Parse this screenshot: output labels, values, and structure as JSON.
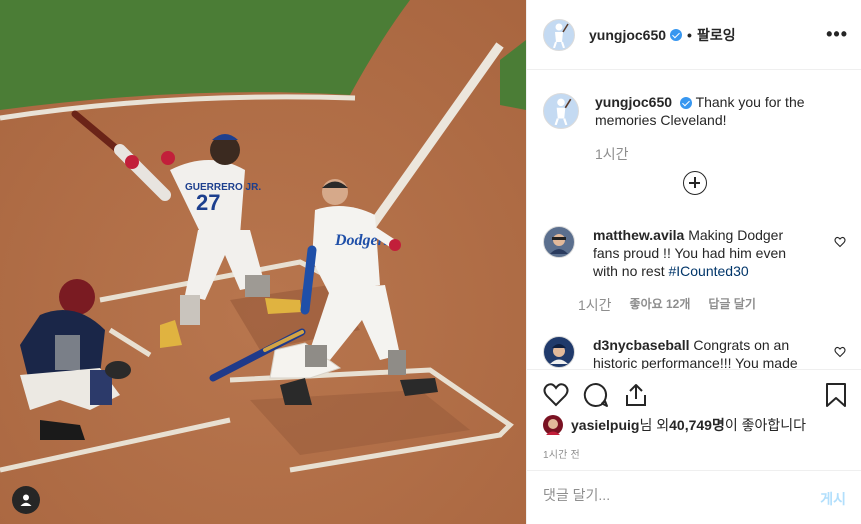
{
  "post": {
    "username": "yungjoc650",
    "separator": "•",
    "follow_label": "팔로잉",
    "more_label": "•••",
    "caption_text": "Thank you for the memories Cleveland!",
    "caption_time": "1시간"
  },
  "photo": {
    "player_left_jersey_name": "GUERRERO JR.",
    "player_left_jersey_number": "27",
    "player_right_jersey_text": "Dodgers"
  },
  "comments": [
    {
      "username": "matthew.avila",
      "text": "Making Dodger fans proud !! You had him even with no rest ",
      "hashtag": "#ICounted30",
      "time": "1시간",
      "likes": "좋아요 12개",
      "reply": "답글 달기"
    },
    {
      "username": "d3nycbaseball",
      "text": "Congrats on an historic performance!!! You made"
    }
  ],
  "likes": {
    "user": "yasielpuig",
    "suffix_1": "님 외 ",
    "count": "40,749명",
    "suffix_2": "이 좋아합니다"
  },
  "timestamp": "1시간 전",
  "add_comment": {
    "placeholder": "댓글 달기...",
    "post_label": "게시"
  },
  "icons": [
    "heart-icon",
    "comment-icon",
    "share-icon",
    "bookmark-icon",
    "user-tag-icon",
    "load-more-icon",
    "verified-icon",
    "more-options-icon"
  ],
  "colors": {
    "link": "#003569",
    "verified": "#3897f0",
    "post_button": "#b2dffc",
    "muted": "#8e8e8e"
  }
}
